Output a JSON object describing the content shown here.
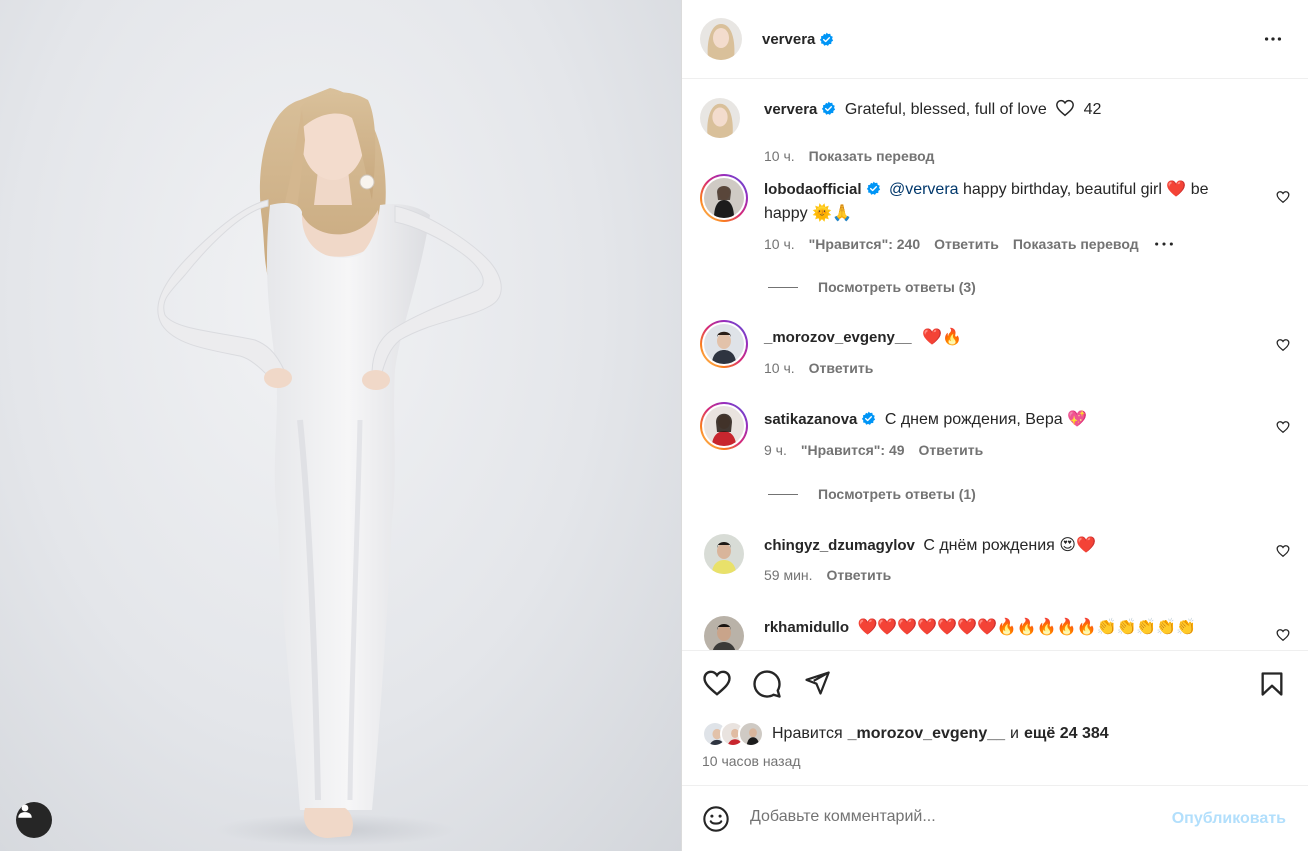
{
  "post": {
    "author": "ververa",
    "more_icon": "more-horizontal-icon"
  },
  "caption": {
    "author": "ververa",
    "text": "Grateful, blessed, full of love",
    "heart_count": "42",
    "time": "10 ч.",
    "translate": "Показать перевод"
  },
  "comments": [
    {
      "author": "lobodaofficial",
      "verified": true,
      "mention": "@ververa",
      "text": " happy birthday, beautiful girl ❤️ be happy 🌞🙏",
      "time": "10 ч.",
      "likes": "\"Нравится\": 240",
      "reply": "Ответить",
      "translate": "Показать перевод",
      "replies_label": "Посмотреть ответы (3)"
    },
    {
      "author": "_morozov_evgeny__",
      "verified": false,
      "text": "❤️🔥",
      "time": "10 ч.",
      "reply": "Ответить"
    },
    {
      "author": "satikazanova",
      "verified": true,
      "text": "С днем рождения, Вера 💖",
      "time": "9 ч.",
      "likes": "\"Нравится\": 49",
      "reply": "Ответить",
      "replies_label": "Посмотреть ответы (1)"
    },
    {
      "author": "chingyz_dzumagylov",
      "verified": false,
      "text": "С днём рождения 😍❤️",
      "time": "59 мин.",
      "reply": "Ответить"
    },
    {
      "author": "rkhamidullo",
      "verified": false,
      "text": "❤️❤️❤️❤️❤️❤️❤️🔥🔥🔥🔥🔥👏👏👏👏👏"
    }
  ],
  "actions": {
    "like_icon": "heart-outline-icon",
    "comment_icon": "comment-icon",
    "share_icon": "send-icon",
    "save_icon": "bookmark-icon"
  },
  "likes": {
    "prefix": "Нравится",
    "user": "_morozov_evgeny__",
    "joiner": "и",
    "others": "ещё 24 384"
  },
  "posted_ago": "10 часов назад",
  "comment_box": {
    "placeholder": "Добавьте комментарий...",
    "publish_label": "Опубликовать",
    "emoji_icon": "emoji-smile-icon"
  },
  "colors": {
    "verified": "#0095f6",
    "publish_disabled": "#b2dffc",
    "secondary_text": "#737373"
  }
}
